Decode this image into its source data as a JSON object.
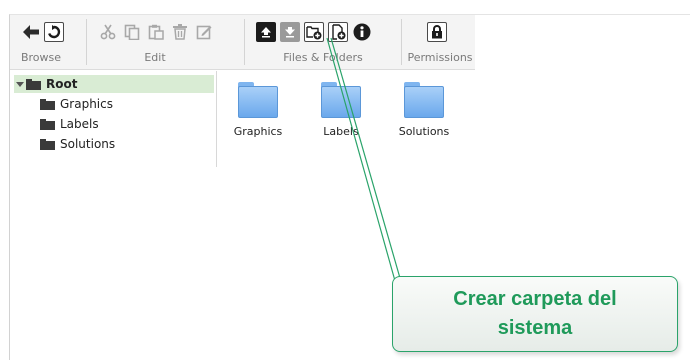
{
  "toolbar": {
    "browse": {
      "label": "Browse",
      "buttons": [
        "back-arrow-icon",
        "refresh-icon"
      ]
    },
    "edit": {
      "label": "Edit",
      "buttons": [
        "cut-icon",
        "copy-icon",
        "paste-icon",
        "delete-icon",
        "rename-icon"
      ]
    },
    "files_folders": {
      "label": "Files & Folders",
      "buttons": [
        "upload-icon",
        "download-icon",
        "create-folder-icon",
        "create-file-icon",
        "info-icon"
      ]
    },
    "permissions": {
      "label": "Permissions",
      "buttons": [
        "lock-icon"
      ]
    }
  },
  "tree": {
    "root": "Root",
    "children": [
      "Graphics",
      "Labels",
      "Solutions"
    ]
  },
  "folders": [
    "Graphics",
    "Labels",
    "Solutions"
  ],
  "callout": {
    "text": "Crear carpeta del sistema"
  },
  "colors": {
    "accent": "#1f9a5a",
    "folder": "#7fb5ef",
    "selection": "#d9ecd4"
  }
}
